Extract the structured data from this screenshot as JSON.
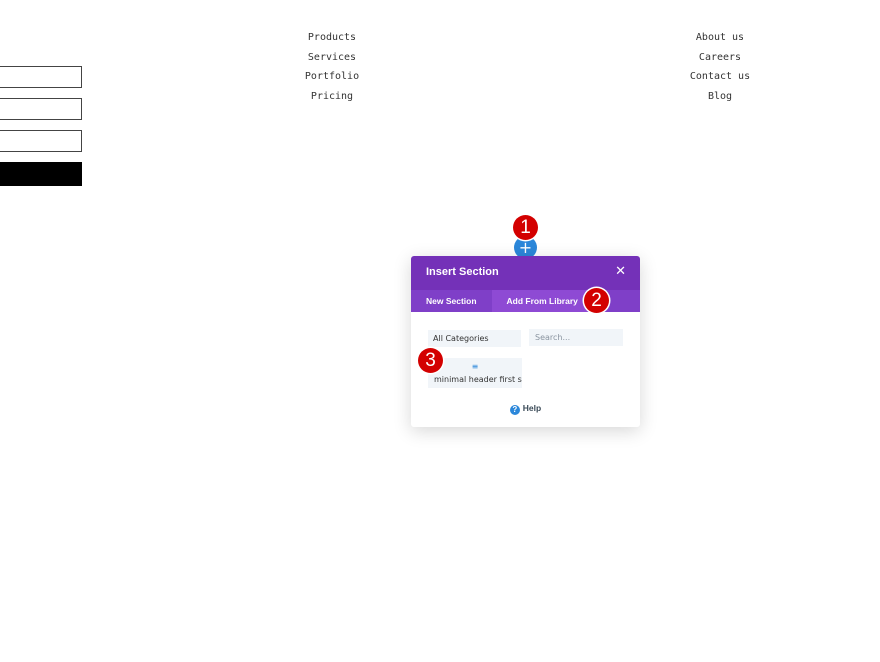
{
  "nav": {
    "left": [
      "Products",
      "Services",
      "Portfolio",
      "Pricing"
    ],
    "right": [
      "About us",
      "Careers",
      "Contact us",
      "Blog"
    ]
  },
  "add_section_button": {
    "icon": "plus-icon",
    "label": "+"
  },
  "badges": [
    "1",
    "2",
    "3"
  ],
  "modal": {
    "title": "Insert Section",
    "close_label": "✕",
    "tabs": [
      {
        "label": "New Section",
        "active": false
      },
      {
        "label": "Add From Library",
        "active": true
      }
    ],
    "category_select": "All Categories",
    "search_placeholder": "Search...",
    "layout_item": {
      "icon": "layout-lines-icon",
      "glyph": "≡",
      "label": "minimal header first section"
    },
    "help": {
      "icon": "question-icon",
      "glyph": "?",
      "label": "Help"
    }
  },
  "colors": {
    "purple_header": "#7431b8",
    "purple_tabs": "#7f3fc8",
    "accent_blue": "#2b87da",
    "badge_red": "#d30000"
  }
}
